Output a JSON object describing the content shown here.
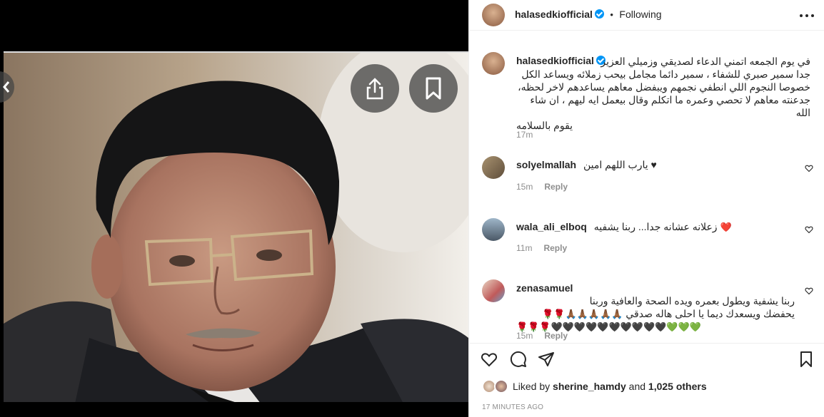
{
  "post": {
    "username": "halasedkiofficial",
    "separator": "•",
    "follow_status": "Following",
    "caption_lines": [
      "في يوم الجمعه اتمني الدعاء لصديقي وزميلي العزيز",
      "جدا سمير صبري للشفاء ، سمير دائما مجامل بيحب زملائه ويساعد الكل",
      "خصوصا النجوم اللي انطفي نجمهم ويبفضل معاهم يساعدهم لاخر لحظه،",
      "جدعنته معاهم لا تحصي وعمره ما اتكلم وقال بيعمل ايه ليهم ، ان شاء الله",
      "يقوم بالسلامه"
    ],
    "caption_time": "17m",
    "liked_by_prefix": "Liked by",
    "liked_by_user": "sherine_hamdy",
    "liked_by_and": "and",
    "liked_by_others": "1,025 others",
    "timestamp": "17 MINUTES AGO"
  },
  "comments": [
    {
      "username": "solyelmallah",
      "text": "يارب اللهم امين ♥",
      "time": "15m",
      "reply": "Reply"
    },
    {
      "username": "wala_ali_elboq",
      "text": "زعلانه عشانه جدا... ربنا يشفيه",
      "emoji": "❤️",
      "time": "11m",
      "reply": "Reply"
    },
    {
      "username": "zenasamuel",
      "text_line1": "ربنا يشفية ويطول بعمره ويده الصحة والعافية وربنا",
      "text_line2": "يحفضك ويسعدك ديما يا احلى هاله صدقي",
      "emoji_line2": "🙏🏾🙏🏾🙏🏾🙏🏾🙏🏾🌹🌹",
      "emoji_line3": "🌹🌹🌹🖤🖤🖤🖤🖤🖤🖤🖤🖤🖤💚💚💚",
      "time": "15m",
      "reply": "Reply"
    }
  ],
  "icons": {
    "more": "more-horizontal-icon",
    "share": "share-icon",
    "bookmark": "bookmark-icon",
    "like": "heart-icon",
    "comment": "comment-icon",
    "send": "send-icon",
    "save": "bookmark-icon"
  },
  "colors": {
    "verified": "#0095f6",
    "text": "#262626",
    "secondary": "#8e8e8e",
    "border": "#efefef"
  }
}
